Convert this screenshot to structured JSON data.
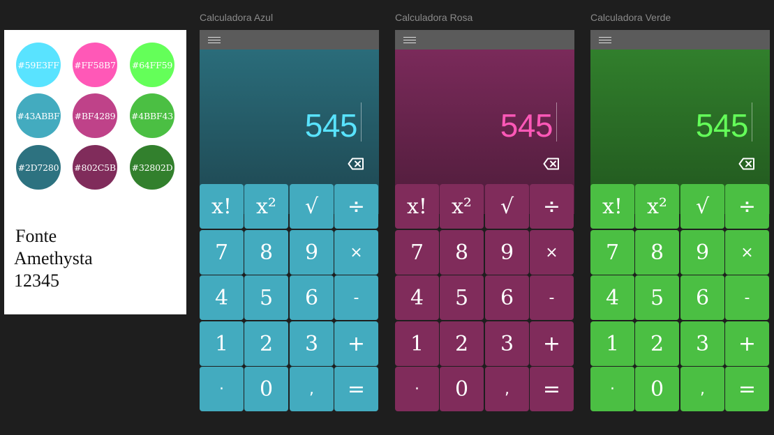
{
  "palette": {
    "swatches": [
      {
        "label": "#59E3FF",
        "color": "#59E3FF"
      },
      {
        "label": "#FF58B7",
        "color": "#FF58B7"
      },
      {
        "label": "#64FF59",
        "color": "#64FF59"
      },
      {
        "label": "#43ABBF",
        "color": "#43ABBF"
      },
      {
        "label": "#BF4289",
        "color": "#BF4289"
      },
      {
        "label": "#4BBF43",
        "color": "#4BBF43"
      },
      {
        "label": "#2D7280",
        "color": "#2D7280"
      },
      {
        "label": "#802C5B",
        "color": "#802C5B"
      },
      {
        "label": "#32802D",
        "color": "#32802D"
      }
    ],
    "font_sample": [
      "Fonte",
      "Amethysta",
      "12345"
    ]
  },
  "calculators": [
    {
      "title": "Calculadora Azul",
      "display": "545",
      "accent": "#59E3FF",
      "key_color": "#43ABBF",
      "display_gradient": [
        "#2A6C7A",
        "#1E4650"
      ],
      "menu_icon": "hamburger-icon",
      "backspace_icon": "backspace-icon",
      "keys": [
        "x!",
        "x²",
        "√",
        "÷",
        "7",
        "8",
        "9",
        "×",
        "4",
        "5",
        "6",
        "-",
        "1",
        "2",
        "3",
        "+",
        "·",
        "0",
        ",",
        "="
      ]
    },
    {
      "title": "Calculadora Rosa",
      "display": "545",
      "accent": "#FF58B7",
      "key_color": "#802C5B",
      "display_gradient": [
        "#7A2A5A",
        "#4E1C3A"
      ],
      "menu_icon": "hamburger-icon",
      "backspace_icon": "backspace-icon",
      "keys": [
        "x!",
        "x²",
        "√",
        "÷",
        "7",
        "8",
        "9",
        "×",
        "4",
        "5",
        "6",
        "-",
        "1",
        "2",
        "3",
        "+",
        "·",
        "0",
        ",",
        "="
      ]
    },
    {
      "title": "Calculadora Verde",
      "display": "545",
      "accent": "#64FF59",
      "key_color": "#4BBF43",
      "display_gradient": [
        "#317F2C",
        "#21561E"
      ],
      "menu_icon": "hamburger-icon",
      "backspace_icon": "backspace-icon",
      "keys": [
        "x!",
        "x²",
        "√",
        "÷",
        "7",
        "8",
        "9",
        "×",
        "4",
        "5",
        "6",
        "-",
        "1",
        "2",
        "3",
        "+",
        "·",
        "0",
        ",",
        "="
      ]
    }
  ]
}
